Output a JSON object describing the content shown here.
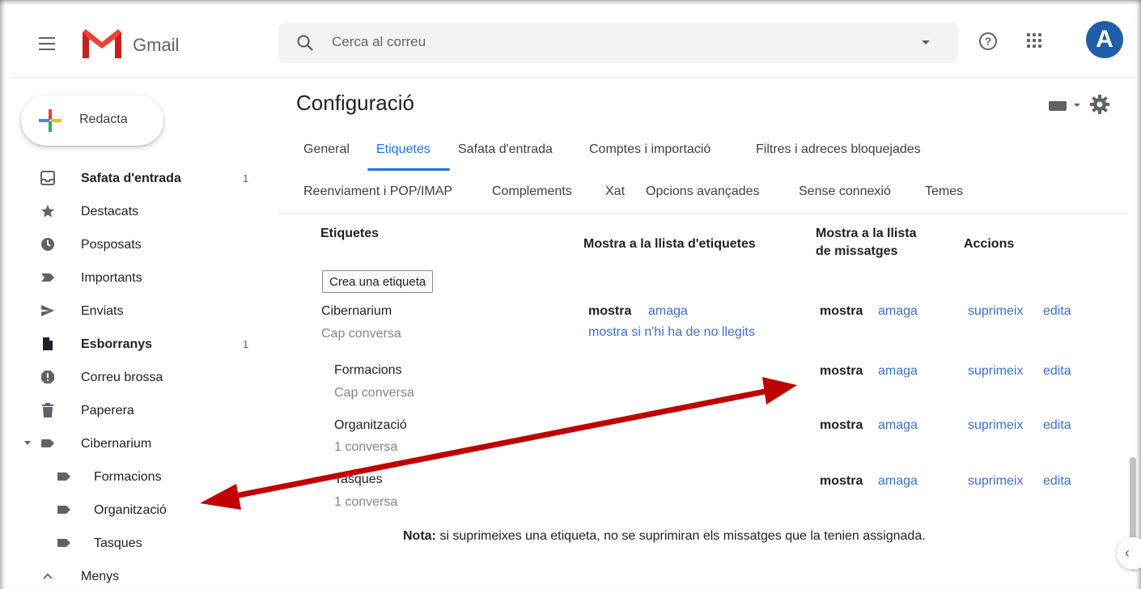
{
  "app": {
    "name": "Gmail"
  },
  "search": {
    "placeholder": "Cerca al correu"
  },
  "header": {
    "help_symbol": "?",
    "avatar_letter": "A"
  },
  "compose": {
    "label": "Redacta"
  },
  "sidebar": {
    "items": [
      {
        "label": "Safata d'entrada",
        "count": "1",
        "bold": true,
        "icon": "inbox-icon"
      },
      {
        "label": "Destacats",
        "count": "",
        "icon": "star-icon"
      },
      {
        "label": "Posposats",
        "count": "",
        "icon": "clock-icon"
      },
      {
        "label": "Importants",
        "count": "",
        "icon": "important-icon"
      },
      {
        "label": "Enviats",
        "count": "",
        "icon": "send-icon"
      },
      {
        "label": "Esborranys",
        "count": "1",
        "bold": true,
        "icon": "draft-icon"
      },
      {
        "label": "Correu brossa",
        "count": "",
        "icon": "spam-icon"
      },
      {
        "label": "Paperera",
        "count": "",
        "icon": "trash-icon"
      },
      {
        "label": "Cibernarium",
        "count": "",
        "icon": "label-icon"
      },
      {
        "label": "Formacions",
        "count": "",
        "icon": "label-icon"
      },
      {
        "label": "Organització",
        "count": "",
        "icon": "label-icon"
      },
      {
        "label": "Tasques",
        "count": "",
        "icon": "label-icon"
      },
      {
        "label": "Menys",
        "count": "",
        "icon": "chevron-up-icon"
      }
    ]
  },
  "page": {
    "title": "Configuració"
  },
  "tabs": {
    "row1": [
      "General",
      "Etiquetes",
      "Safata d'entrada",
      "Comptes i importació",
      "Filtres i adreces bloquejades"
    ],
    "row2": [
      "Reenviament i POP/IMAP",
      "Complements",
      "Xat",
      "Opcions avançades",
      "Sense connexió",
      "Temes"
    ],
    "active": "Etiquetes"
  },
  "table": {
    "headers": {
      "labels": "Etiquetes",
      "show_in_label_list": "Mostra a la llista d'etiquetes",
      "show_in_message_list_1": "Mostra a la llista",
      "show_in_message_list_2": "de missatges",
      "actions": "Accions"
    },
    "create_button": "Crea una etiqueta",
    "rows": [
      {
        "name": "Cibernarium",
        "sub": "Cap conversa",
        "list_show": "mostra",
        "list_hide": "amaga",
        "list_unread": "mostra si n'hi ha de no llegits",
        "msg_show": "mostra",
        "msg_hide": "amaga",
        "delete": "suprimeix",
        "edit": "edita"
      },
      {
        "name": "Formacions",
        "sub": "Cap conversa",
        "msg_show": "mostra",
        "msg_hide": "amaga",
        "delete": "suprimeix",
        "edit": "edita"
      },
      {
        "name": "Organització",
        "sub": "1 conversa",
        "msg_show": "mostra",
        "msg_hide": "amaga",
        "delete": "suprimeix",
        "edit": "edita"
      },
      {
        "name": "Tasques",
        "sub": "1 conversa",
        "msg_show": "mostra",
        "msg_hide": "amaga",
        "delete": "suprimeix",
        "edit": "edita"
      }
    ],
    "note_bold": "Nota:",
    "note_text": " si suprimeixes una etiqueta, no se suprimiran els missatges que la tenien assignada."
  },
  "colors": {
    "accent": "#1a73e8",
    "link": "#3b6fc5",
    "annotation_arrow": "#c00000",
    "avatar_bg": "#1f5fa8"
  }
}
